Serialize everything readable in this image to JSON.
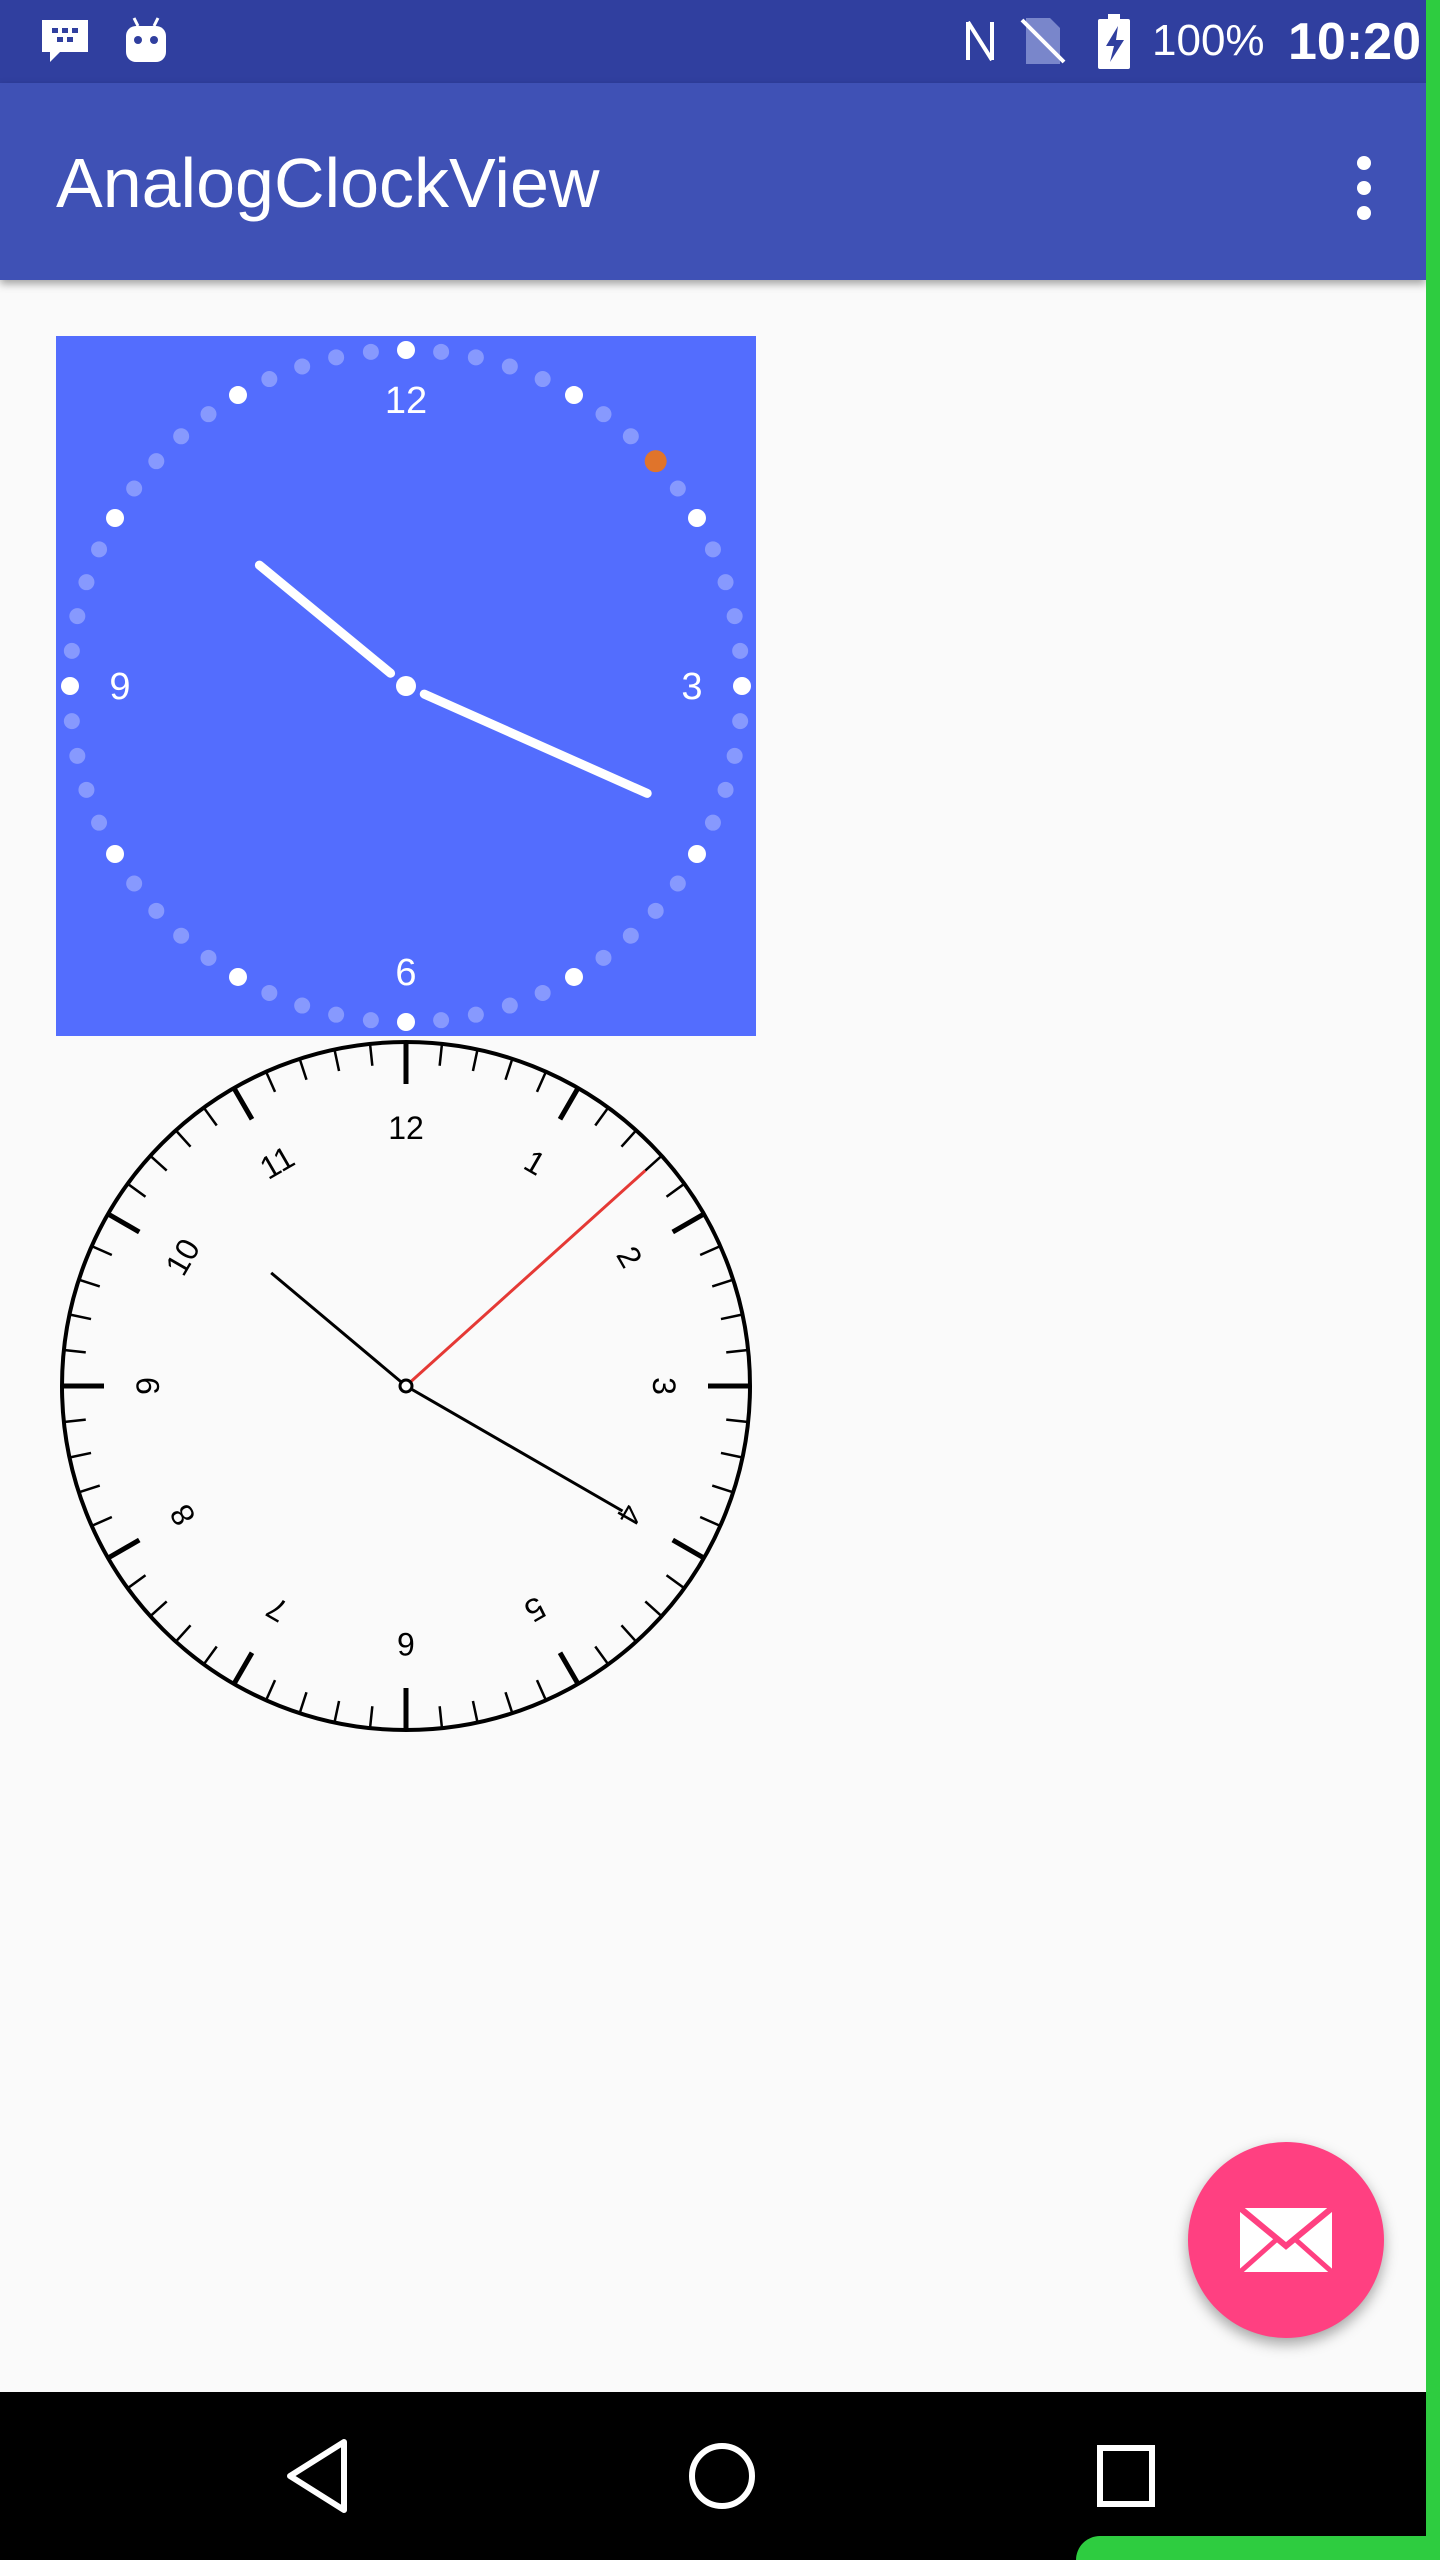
{
  "status_bar": {
    "battery_percent": "100%",
    "time": "10:20",
    "icons": [
      "messenger-icon",
      "android-icon",
      "nfc-icon",
      "no-sim-icon",
      "battery-charging-icon"
    ]
  },
  "app_bar": {
    "title": "AnalogClockView",
    "overflow_icon": "more-vert-icon"
  },
  "clock_styled": {
    "background": "#536dfe",
    "numerals": [
      "12",
      "3",
      "6",
      "9"
    ],
    "hour": 10,
    "minute": 19,
    "second": 8,
    "second_dot_color": "#e0742b"
  },
  "clock_classic": {
    "numerals": [
      "12",
      "1",
      "2",
      "3",
      "4",
      "5",
      "6",
      "7",
      "8",
      "9",
      "10",
      "11"
    ],
    "hour": 10,
    "minute": 20,
    "second": 8,
    "second_hand_color": "#e53935"
  },
  "fab": {
    "icon": "mail-icon",
    "color": "#ff4081"
  },
  "nav_bar": {
    "icons": [
      "back-icon",
      "home-icon",
      "recents-icon"
    ]
  }
}
